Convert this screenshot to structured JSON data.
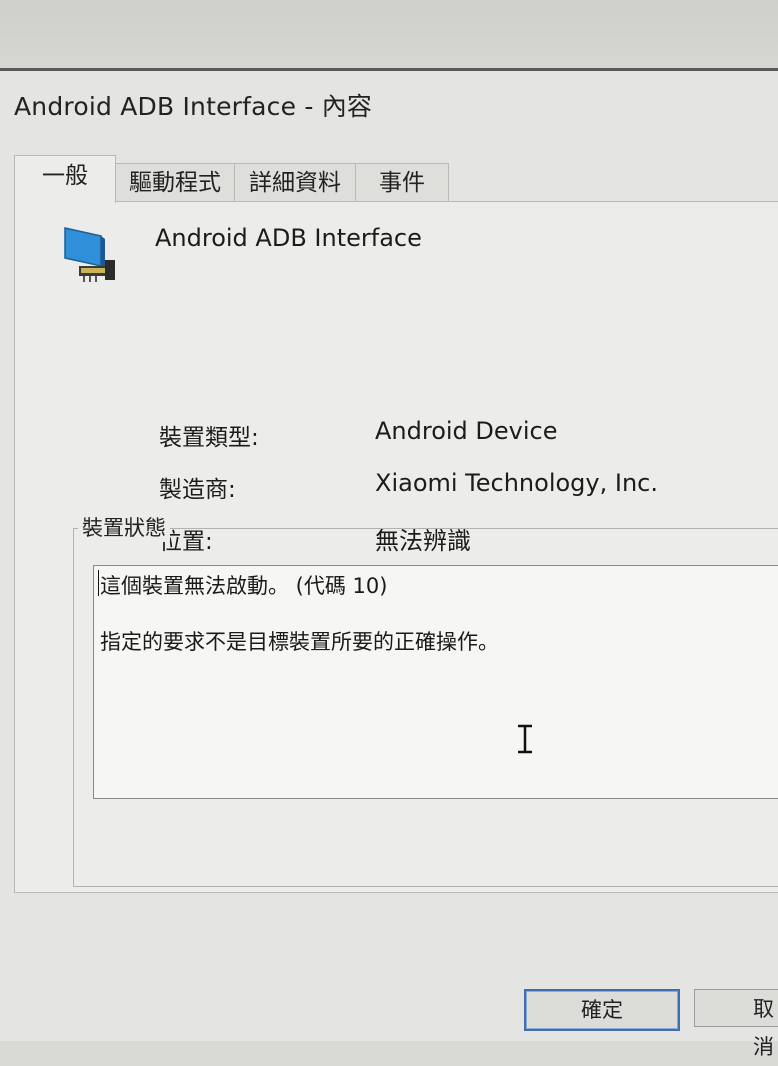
{
  "window": {
    "title": "Android ADB Interface - 內容"
  },
  "tabs": [
    {
      "label": "一般"
    },
    {
      "label": "驅動程式"
    },
    {
      "label": "詳細資料"
    },
    {
      "label": "事件"
    }
  ],
  "device": {
    "icon": "network-adapter-icon",
    "name": "Android ADB Interface"
  },
  "properties": [
    {
      "label": "裝置類型:",
      "value": "Android Device"
    },
    {
      "label": "製造商:",
      "value": "Xiaomi Technology, Inc."
    },
    {
      "label": "位置:",
      "value": "無法辨識"
    }
  ],
  "status": {
    "group_title": "裝置狀態",
    "line1": "這個裝置無法啟動。 (代碼 10)",
    "line2": "指定的要求不是目標裝置所要的正確操作。"
  },
  "buttons": {
    "ok": "確定",
    "cancel": "取消"
  },
  "colors": {
    "window_bg": "#e4e4e2",
    "panel_bg": "#ececea",
    "default_button_border": "#3f6fb0",
    "icon_blue": "#2f8fd8"
  }
}
